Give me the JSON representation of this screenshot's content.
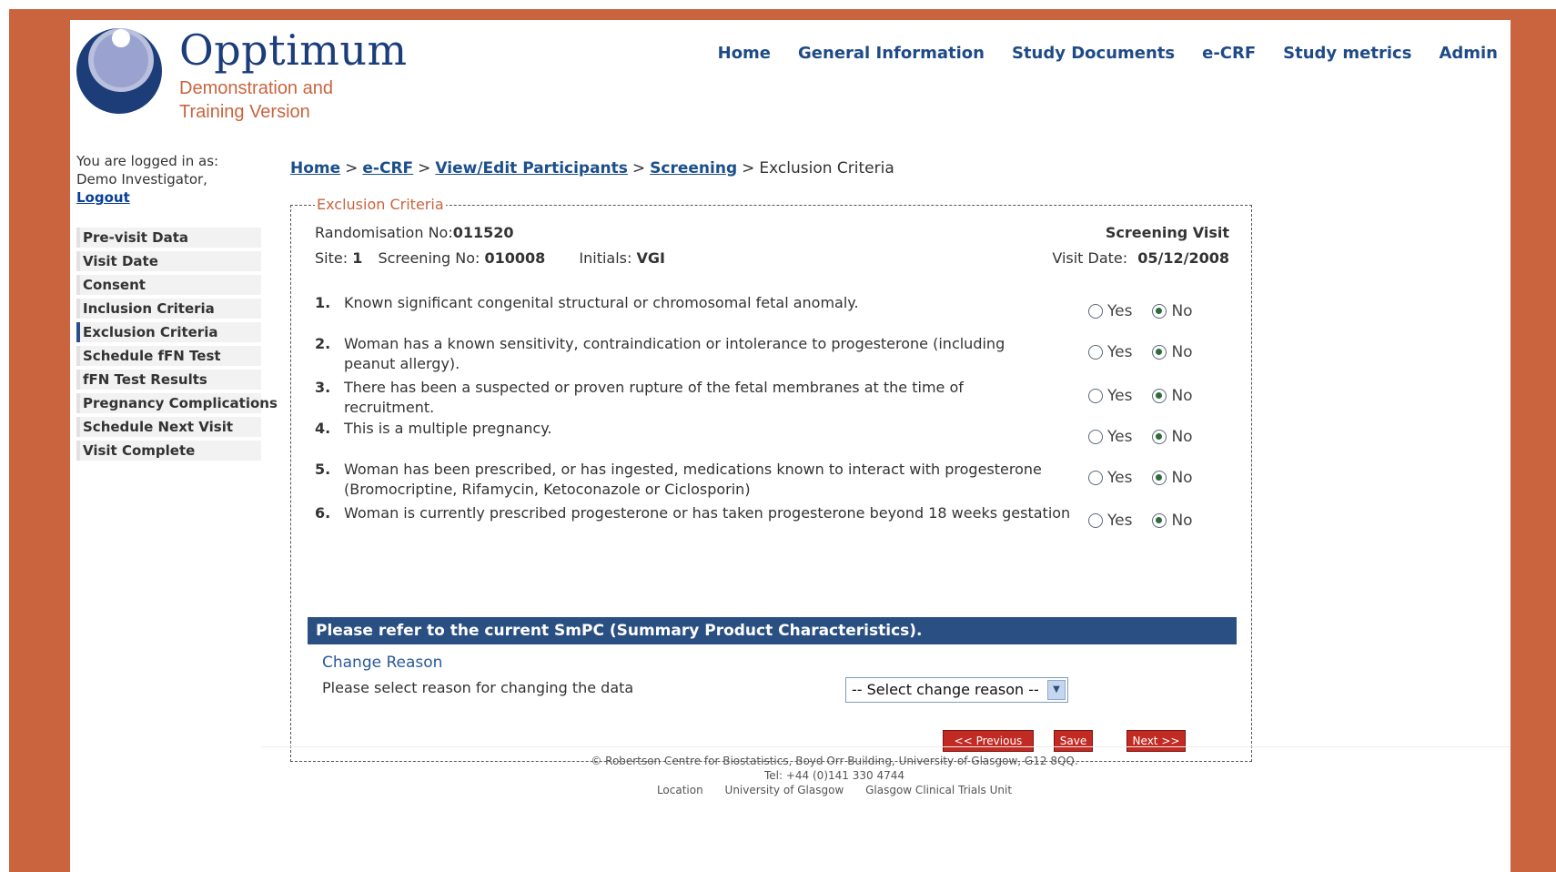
{
  "logo": {
    "name": "Opptimum",
    "subtitle": "Demonstration and Training Version"
  },
  "topnav": [
    "Home",
    "General Information",
    "Study Documents",
    "e-CRF",
    "Study metrics",
    "Admin"
  ],
  "login": {
    "line1": "You are logged in as:",
    "user": "Demo Investigator,",
    "logout": "Logout"
  },
  "sidemenu": [
    "Pre-visit Data",
    "Visit Date",
    "Consent",
    "Inclusion Criteria",
    "Exclusion Criteria",
    "Schedule fFN Test",
    "fFN Test Results",
    "Pregnancy Complications",
    "Schedule Next Visit",
    "Visit Complete"
  ],
  "sidemenu_active": "Exclusion Criteria",
  "breadcrumb": {
    "links": [
      "Home",
      "e-CRF",
      "View/Edit Participants",
      "Screening"
    ],
    "current": "Exclusion Criteria",
    "separator": ">"
  },
  "form": {
    "legend": "Exclusion Criteria",
    "randomisation_label": "Randomisation No:",
    "randomisation_no": "011520",
    "site_label": "Site:",
    "site": "1",
    "screening_label": "Screening No:",
    "screening_no": "010008",
    "initials_label": "Initials:",
    "initials": "VGI",
    "visit_title": "Screening Visit",
    "visit_date_label": "Visit Date:",
    "visit_date": "05/12/2008",
    "yes_label": "Yes",
    "no_label": "No",
    "questions": [
      {
        "num": "1.",
        "text": "Known significant congenital structural or chromosomal fetal anomaly.",
        "answer": "No"
      },
      {
        "num": "2.",
        "text": "Woman has a known sensitivity, contraindication or intolerance to progesterone (including peanut allergy).",
        "answer": "No"
      },
      {
        "num": "3.",
        "text": "There has been a suspected or proven rupture of the fetal membranes at the time of recruitment.",
        "answer": "No"
      },
      {
        "num": "4.",
        "text": "This is a multiple pregnancy.",
        "answer": "No"
      },
      {
        "num": "5.",
        "text": "Woman has been prescribed, or has ingested, medications known to interact with progesterone (Bromocriptine, Rifamycin, Ketoconazole or Ciclosporin)",
        "answer": "No"
      },
      {
        "num": "6.",
        "text": "Woman is currently prescribed progesterone or has taken progesterone beyond 18 weeks gestation",
        "answer": "No"
      }
    ],
    "notice": "Please refer to the current SmPC (Summary Product Characteristics).",
    "change_reason_title": "Change Reason",
    "change_reason_label": "Please select reason for changing the data",
    "change_reason_select": "-- Select change reason --",
    "buttons": {
      "previous": "<< Previous",
      "save": "Save",
      "next": "Next >>"
    }
  },
  "footer": {
    "line1": "© Robertson Centre for Biostatistics, Boyd Orr Building, University of Glasgow, G12 8QQ.",
    "line2": "Tel: +44 (0)141 330 4744",
    "links": [
      "Location",
      "University of Glasgow",
      "Glasgow Clinical Trials Unit"
    ]
  },
  "colors": {
    "frame": "#c9643f",
    "nav": "#1e4a87",
    "notice_bar": "#2a4f82",
    "button": "#c22b24"
  }
}
